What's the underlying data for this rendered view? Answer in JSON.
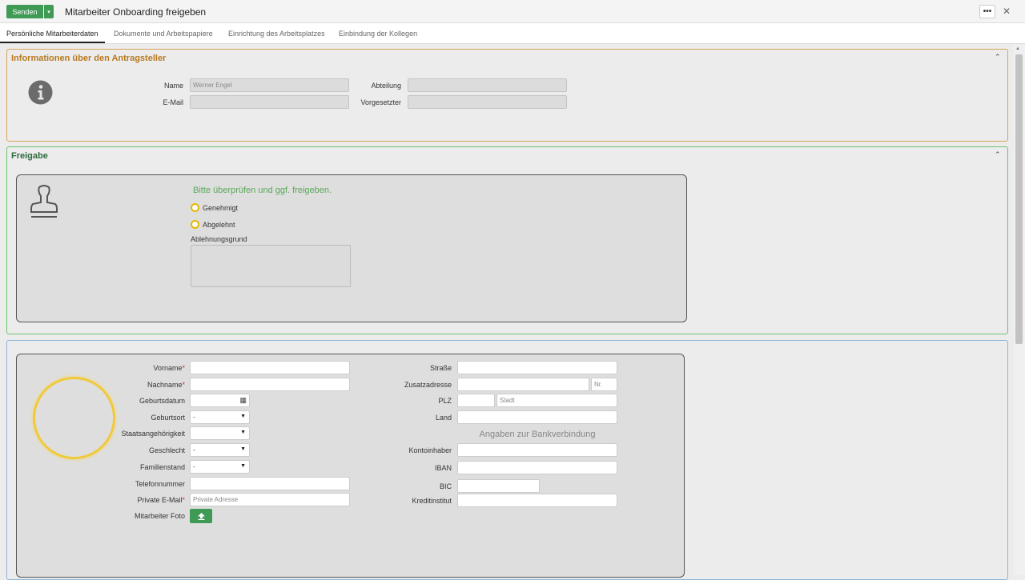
{
  "toolbar": {
    "send_label": "Senden",
    "title": "Mitarbeiter Onboarding freigeben",
    "more_label": "•••",
    "close_label": "✕"
  },
  "tabs": [
    {
      "label": "Persönliche Mitarbeiterdaten"
    },
    {
      "label": "Dokumente und Arbeitspapiere"
    },
    {
      "label": "Einrichtung des Arbeitsplatzes"
    },
    {
      "label": "Einbindung der Kollegen"
    }
  ],
  "applicant": {
    "title": "Informationen über den Antragsteller",
    "name_label": "Name",
    "name_value": "Werner Engel",
    "email_label": "E-Mail",
    "email_value": "",
    "department_label": "Abteilung",
    "department_value": "",
    "supervisor_label": "Vorgesetzter",
    "supervisor_value": ""
  },
  "approval": {
    "title": "Freigabe",
    "prompt": "Bitte überprüfen und ggf. freigeben.",
    "option_approved": "Genehmigt",
    "option_rejected": "Abgelehnt",
    "reason_label": "Ablehnungsgrund"
  },
  "personal": {
    "firstname_label": "Vorname",
    "lastname_label": "Nachname",
    "birthdate_label": "Geburtsdatum",
    "birthplace_label": "Geburtsort",
    "birthplace_value": "-",
    "nationality_label": "Staatsangehörigkeit",
    "nationality_value": "",
    "gender_label": "Geschlecht",
    "gender_value": "-",
    "marital_label": "Familienstand",
    "marital_value": "-",
    "phone_label": "Telefonnummer",
    "private_email_label": "Private E-Mail",
    "private_email_placeholder": "Private Adresse",
    "photo_label": "Mitarbeiter Foto",
    "required_mark": "*"
  },
  "address": {
    "street_label": "Straße",
    "extra_label": "Zusatzadresse",
    "nr_placeholder": "Nr.",
    "zip_label": "PLZ",
    "city_placeholder": "Stadt",
    "country_label": "Land"
  },
  "bank": {
    "heading": "Angaben zur Bankverbindung",
    "holder_label": "Kontoinhaber",
    "iban_label": "IBAN",
    "bic_label": "BIC",
    "institute_label": "Kreditinstitut"
  },
  "colors": {
    "accent_green": "#3e9a55",
    "orange_border": "#d9a45a",
    "green_border": "#6cc46c",
    "blue_border": "#8fb5d6",
    "radio_yellow": "#e6b800"
  }
}
